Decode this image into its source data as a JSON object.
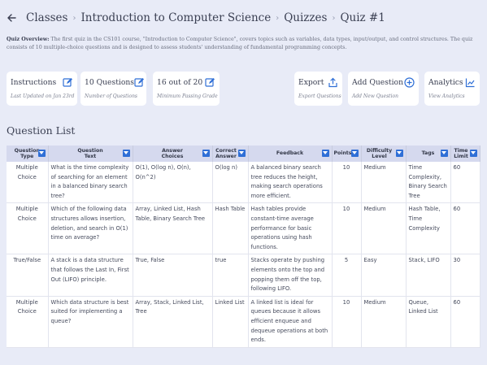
{
  "breadcrumb": {
    "items": [
      "Classes",
      "Introduction to Computer Science",
      "Quizzes",
      "Quiz #1"
    ]
  },
  "overview": {
    "label": "Quiz Overview:",
    "text": " The first quiz in the CS101 course, \"Introduction to Computer Science\", covers topics such as variables, data types, input/output, and control structures. The quiz consists of 10 multiple-choice questions and is designed to assess students' understanding of fundamental programming concepts."
  },
  "cards": {
    "instructions": {
      "title": "Instructions",
      "sub": "Last Updated on Jan 23rd",
      "icon": "edit-icon"
    },
    "questions": {
      "title": "10 Questions",
      "sub": "Number of Questions",
      "icon": "edit-icon"
    },
    "passing": {
      "title": "16 out of 20",
      "sub": "Minimum Passing Grade",
      "icon": "edit-icon"
    },
    "export": {
      "title": "Export",
      "sub": "Export Questions",
      "icon": "share-icon"
    },
    "add_question": {
      "title": "Add Question",
      "sub": "Add New Question",
      "icon": "plus-circle-icon"
    },
    "analytics": {
      "title": "Analytics",
      "sub": "View Analytics",
      "icon": "chart-icon"
    }
  },
  "question_list": {
    "title": "Question List",
    "headers": [
      "Question Type",
      "Question Text",
      "Answer Choices",
      "Correct Answer",
      "Feedback",
      "Points",
      "Difficulty Level",
      "Tags",
      "Time Limit"
    ],
    "rows": [
      {
        "type": "Multiple Choice",
        "text": "What is the time complexity of searching for an element in a balanced binary search tree?",
        "choices": "O(1), O(log n), O(n), O(n^2)",
        "answer": "O(log n)",
        "feedback": "A balanced binary search tree reduces the height, making search operations more efficient.",
        "points": "10",
        "difficulty": "Medium",
        "tags": "Time Complexity, Binary Search Tree",
        "time": "60"
      },
      {
        "type": "Multiple Choice",
        "text": "Which of the following data structures allows insertion, deletion, and search in O(1) time on average?",
        "choices": "Array, Linked List, Hash Table, Binary Search Tree",
        "answer": "Hash Table",
        "feedback": "Hash tables provide constant-time average performance for basic operations using hash functions.",
        "points": "10",
        "difficulty": "Medium",
        "tags": "Hash Table, Time Complexity",
        "time": "60"
      },
      {
        "type": "True/False",
        "text": "A stack is a data structure that follows the Last In, First Out (LIFO) principle.",
        "choices": "True, False",
        "answer": "true",
        "feedback": "Stacks operate by pushing elements onto the top and popping them off the top, following LIFO.",
        "points": "5",
        "difficulty": "Easy",
        "tags": "Stack, LIFO",
        "time": "30"
      },
      {
        "type": "Multiple Choice",
        "text": "Which data structure is best suited for implementing a queue?",
        "choices": "Array, Stack, Linked List, Tree",
        "answer": "Linked List",
        "feedback": "A linked list is ideal for queues because it allows efficient enqueue and dequeue operations at both ends.",
        "points": "10",
        "difficulty": "Medium",
        "tags": "Queue, Linked List",
        "time": "60"
      }
    ]
  },
  "colors": {
    "accent": "#2f6fd6",
    "background": "#e8ebf7",
    "header": "#d5d9ee"
  }
}
